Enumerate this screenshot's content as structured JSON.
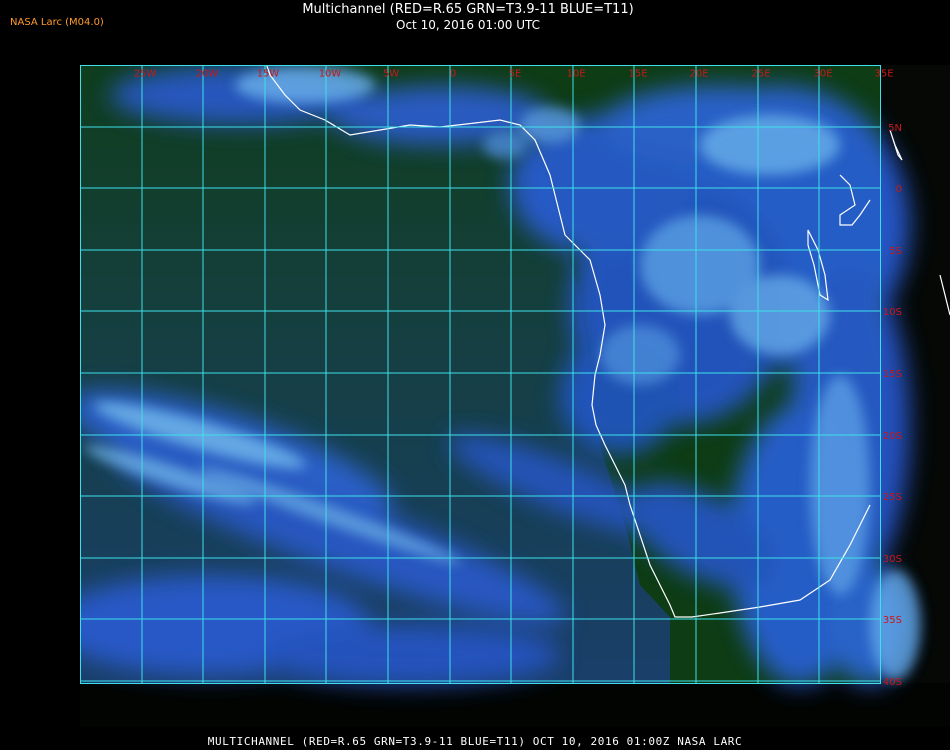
{
  "header": {
    "credit": "NASA Larc (M04.0)",
    "title": "Multichannel (RED=R.65 GRN=T3.9-11 BLUE=T11)",
    "subtitle": "Oct 10, 2016 01:00 UTC"
  },
  "grid": {
    "lon_labels": [
      "25W",
      "20W",
      "15W",
      "10W",
      "5W",
      "0",
      "5E",
      "10E",
      "15E",
      "20E",
      "25E",
      "30E",
      "35E"
    ],
    "lat_labels": [
      "5N",
      "0",
      "5S",
      "10S",
      "15S",
      "20S",
      "25S",
      "30S",
      "35S",
      "40S"
    ],
    "line_color": "#3de0ea",
    "label_color": "#c81818"
  },
  "colors": {
    "ocean": "#17404f",
    "land_green": "#0f3f16",
    "cloud_blue": "#2b64e8",
    "cloud_bright": "#69b3ea",
    "coast": "#ffffff"
  },
  "footer": {
    "caption": "MULTICHANNEL (RED=R.65 GRN=T3.9-11 BLUE=T11) OCT 10, 2016 01:00Z   NASA LARC"
  }
}
